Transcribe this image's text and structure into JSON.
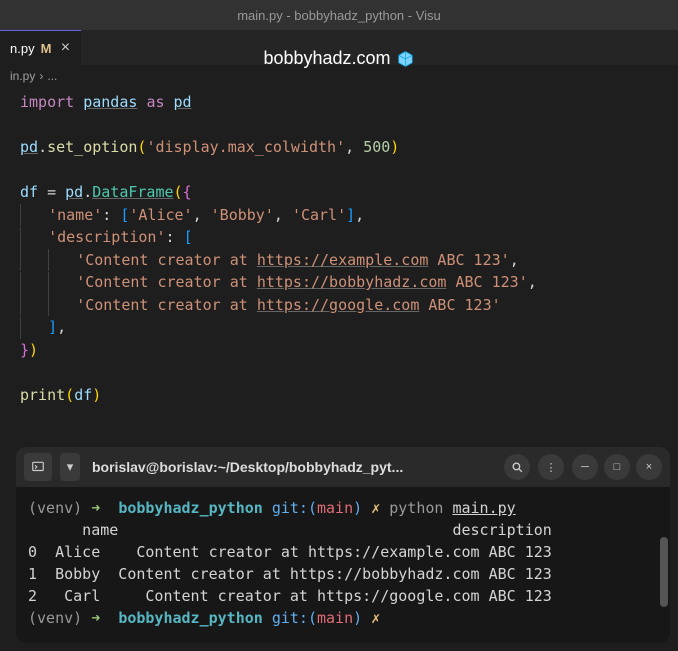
{
  "titlebar": {
    "text": "main.py - bobbyhadz_python - Visu"
  },
  "watermark": {
    "text": "bobbyhadz.com"
  },
  "tab": {
    "filename": "n.py",
    "modified": "M"
  },
  "breadcrumb": {
    "file": "in.py",
    "sep": "›",
    "rest": "..."
  },
  "code": {
    "l1": {
      "import": "import",
      "pandas": "pandas",
      "as": "as",
      "pd": "pd"
    },
    "l3": {
      "pd": "pd",
      "dot": ".",
      "set_option": "set_option",
      "lp": "(",
      "arg1": "'display.max_colwidth'",
      "comma": ", ",
      "num": "500",
      "rp": ")"
    },
    "l5": {
      "df": "df",
      "eq": " = ",
      "pd": "pd",
      "dot": ".",
      "dataframe": "DataFrame",
      "lp": "(",
      "lb": "{"
    },
    "l6": {
      "key": "'name'",
      "colon": ": ",
      "lb": "[",
      "a": "'Alice'",
      "c1": ", ",
      "b": "'Bobby'",
      "c2": ", ",
      "c": "'Carl'",
      "rb": "]",
      "comma": ","
    },
    "l7": {
      "key": "'description'",
      "colon": ": ",
      "lb": "["
    },
    "l8": {
      "s1": "'Content creator at ",
      "url": "https://example.com",
      "s2": " ABC 123'",
      "comma": ","
    },
    "l9": {
      "s1": "'Content creator at ",
      "url": "https://bobbyhadz.com",
      "s2": " ABC 123'",
      "comma": ","
    },
    "l10": {
      "s1": "'Content creator at ",
      "url": "https://google.com",
      "s2": " ABC 123'"
    },
    "l11": {
      "rb": "]",
      "comma": ","
    },
    "l12": {
      "rb": "}",
      "rp": ")"
    },
    "l14": {
      "print": "print",
      "lp": "(",
      "df": "df",
      "rp": ")"
    }
  },
  "terminal": {
    "title": "borislav@borislav:~/Desktop/bobbyhadz_pyt...",
    "venv": "(venv)",
    "arrow": "➜",
    "dir": "bobbyhadz_python",
    "git": "git:(",
    "branch": "main",
    "gitclose": ")",
    "dirty": "✗",
    "cmd_python": "python",
    "cmd_file": "main.py",
    "out_header": "      name                                     description",
    "out_r0": "0  Alice    Content creator at https://example.com ABC 123",
    "out_r1": "1  Bobby  Content creator at https://bobbyhadz.com ABC 123",
    "out_r2": "2   Carl     Content creator at https://google.com ABC 123"
  }
}
